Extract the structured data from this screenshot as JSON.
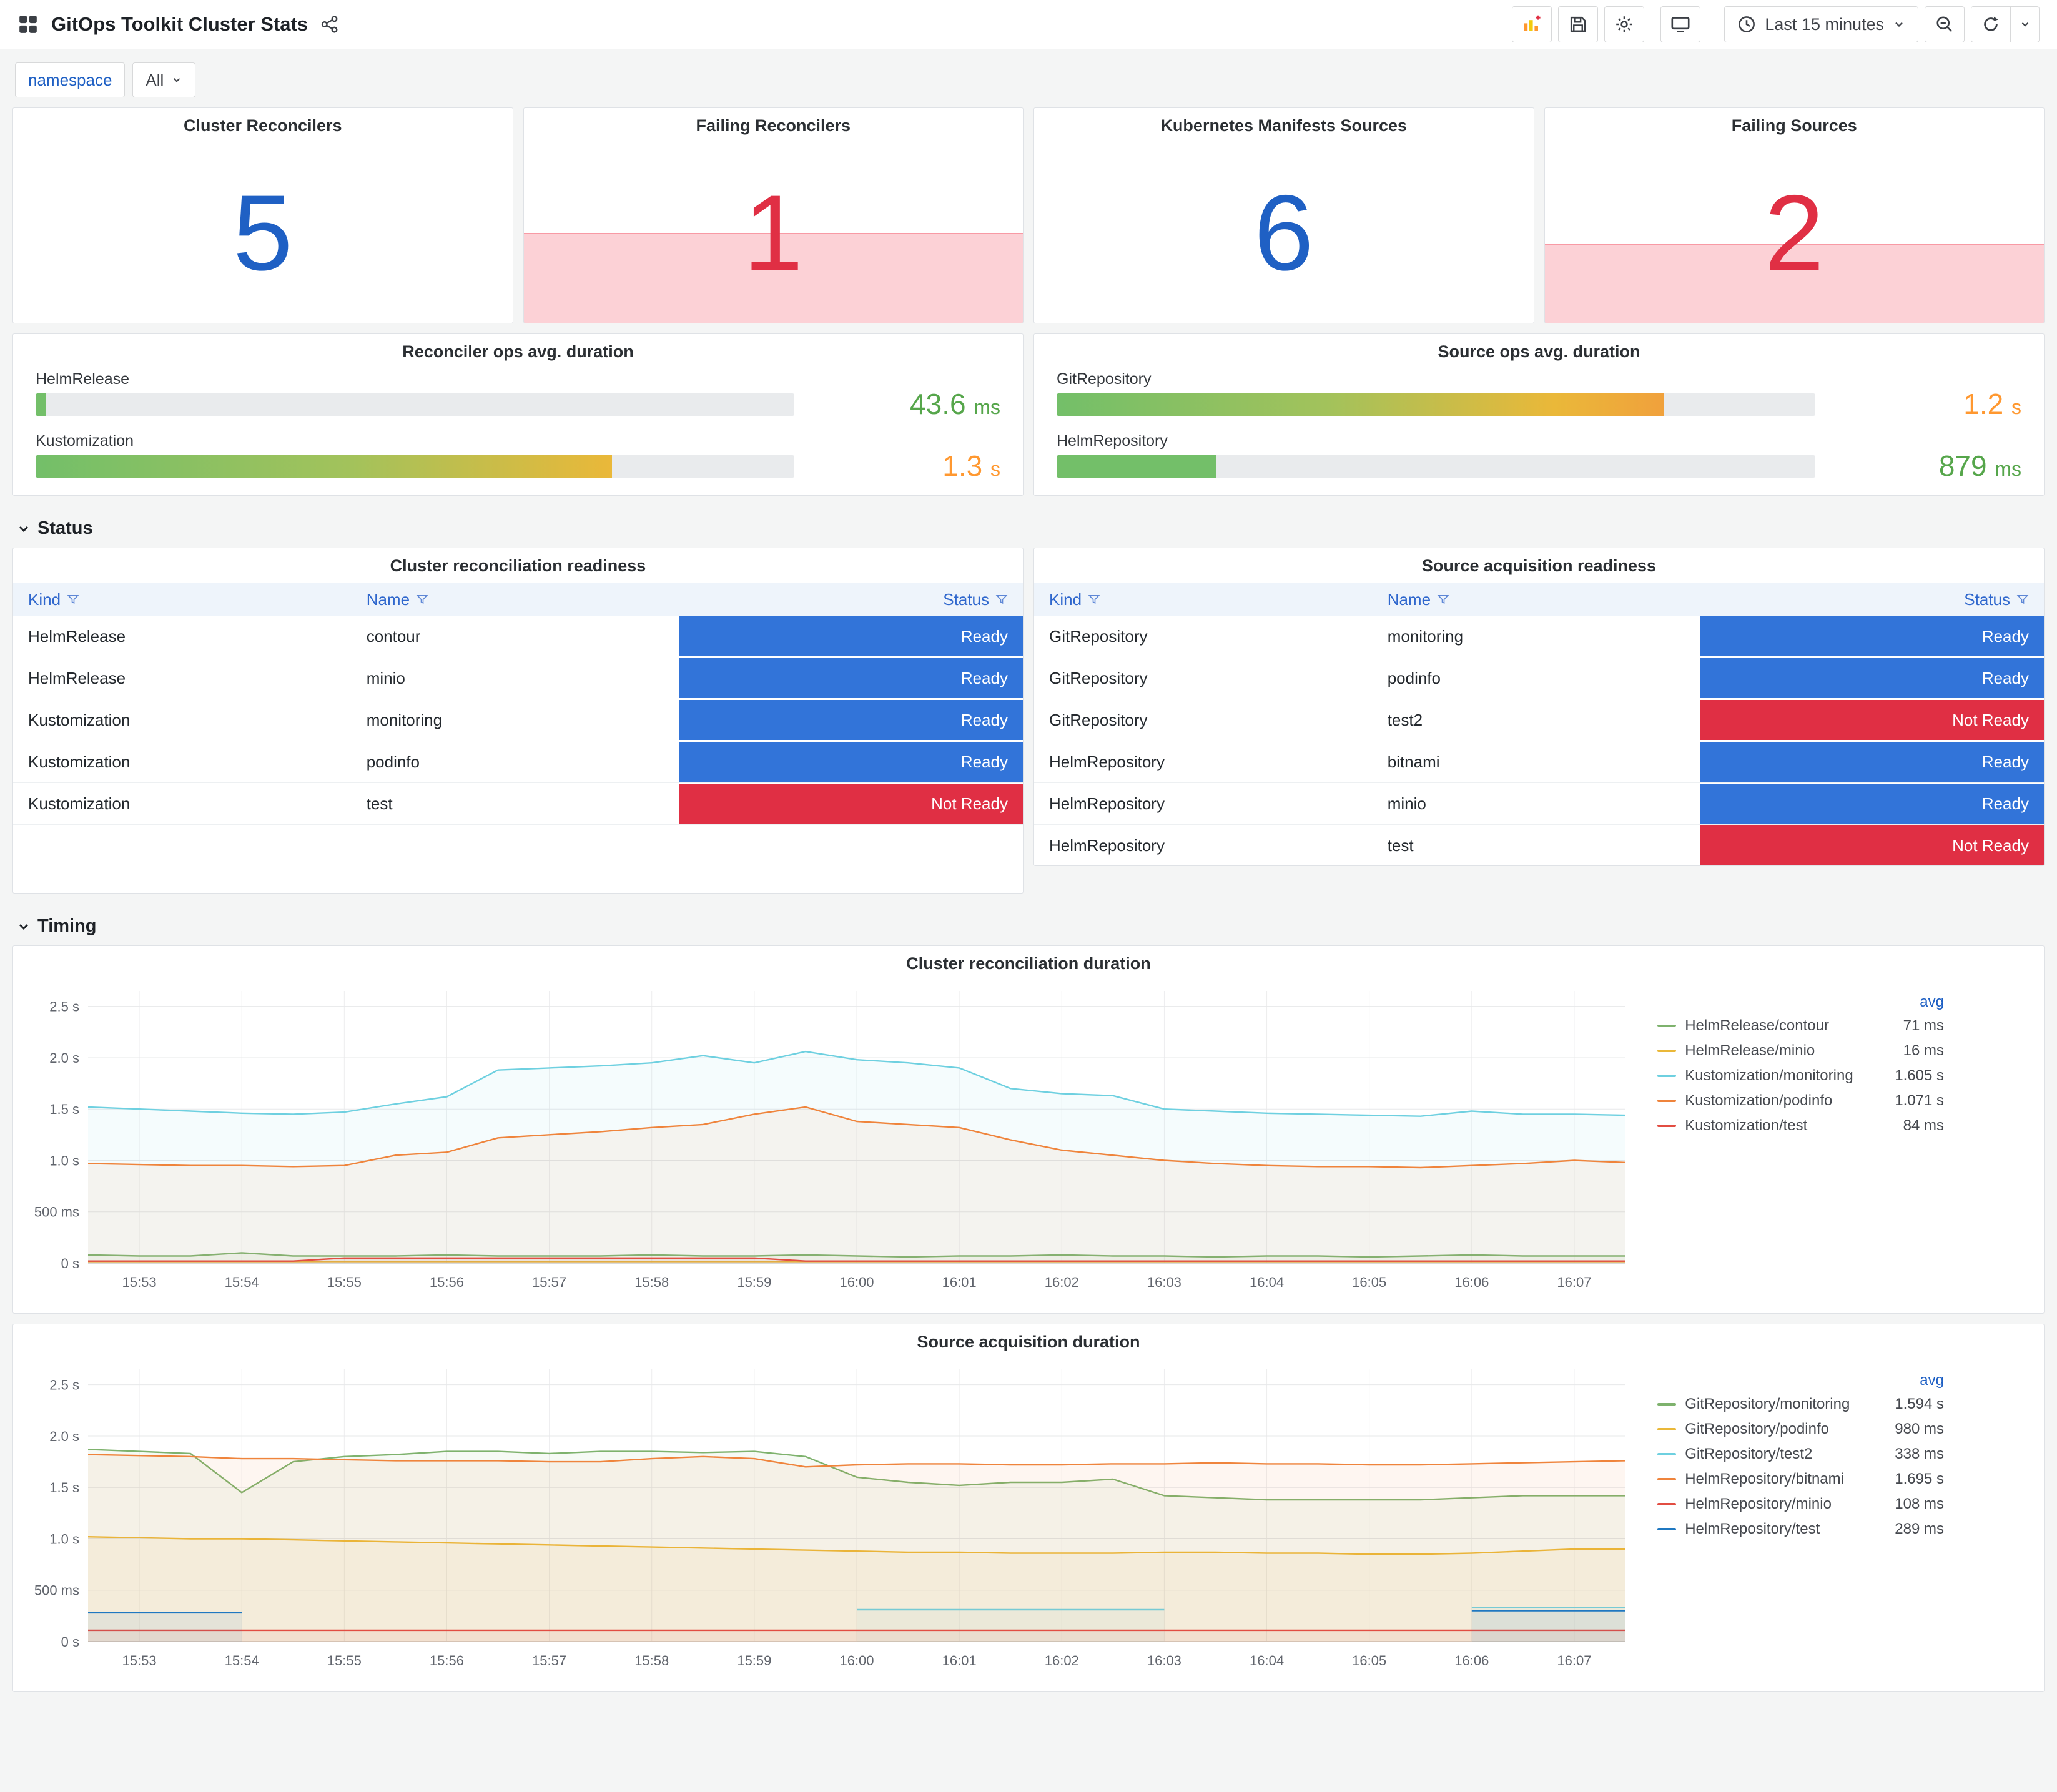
{
  "header": {
    "title": "GitOps Toolkit Cluster Stats",
    "time_picker": "Last 15 minutes"
  },
  "icons": {
    "dashboards-icon": "four-square grid",
    "share-icon": "share-alt nodes",
    "add-panel-icon": "bar chart with plus",
    "save-icon": "floppy disk",
    "settings-icon": "gear",
    "tv-icon": "monitor",
    "clock-icon": "clock",
    "caret-down-icon": "chevron down",
    "zoom-out-icon": "magnifier with minus",
    "refresh-icon": "circular arrow",
    "filter-icon": "funnel",
    "section-chevron-icon": "chevron down"
  },
  "variables": {
    "namespace_label": "namespace",
    "namespace_value": "All"
  },
  "sections": {
    "status": "Status",
    "timing": "Timing"
  },
  "stats": [
    {
      "title": "Cluster Reconcilers",
      "value": "5",
      "color": "#1F60C4",
      "band": false,
      "band_height_pct": 0
    },
    {
      "title": "Failing Reconcilers",
      "value": "1",
      "color": "#E02F44",
      "band": true,
      "band_height_pct": 42
    },
    {
      "title": "Kubernetes Manifests Sources",
      "value": "6",
      "color": "#1F60C4",
      "band": false,
      "band_height_pct": 0
    },
    {
      "title": "Failing Sources",
      "value": "2",
      "color": "#E02F44",
      "band": true,
      "band_height_pct": 37
    }
  ],
  "gauges": [
    {
      "title": "Reconciler ops avg. duration",
      "rows": [
        {
          "label": "HelmRelease",
          "value": "43.6",
          "unit": "ms",
          "percent": 1.3,
          "bar_colors": [
            "#73BF69",
            "#73BF69"
          ],
          "value_color": "#56A64B"
        },
        {
          "label": "Kustomization",
          "value": "1.3",
          "unit": "s",
          "percent": 76,
          "bar_colors": [
            "#73BF69",
            "#A3C25B 55%",
            "#EAB839"
          ],
          "value_color": "#FF9830"
        }
      ]
    },
    {
      "title": "Source ops avg. duration",
      "rows": [
        {
          "label": "GitRepository",
          "value": "1.2",
          "unit": "s",
          "percent": 80,
          "bar_colors": [
            "#73BF69",
            "#A3C25B 45%",
            "#EAB839 82%",
            "#F0A13C"
          ],
          "value_color": "#FF9830"
        },
        {
          "label": "HelmRepository",
          "value": "879",
          "unit": "ms",
          "percent": 21,
          "bar_colors": [
            "#73BF69",
            "#73BF69"
          ],
          "value_color": "#56A64B"
        }
      ]
    }
  ],
  "status_colors": {
    "Ready": "#3274D9",
    "Not Ready": "#E02F44"
  },
  "tables": [
    {
      "title": "Cluster reconciliation readiness",
      "columns": [
        "Kind",
        "Name",
        "Status"
      ],
      "rows": [
        {
          "kind": "HelmRelease",
          "name": "contour",
          "status": "Ready"
        },
        {
          "kind": "HelmRelease",
          "name": "minio",
          "status": "Ready"
        },
        {
          "kind": "Kustomization",
          "name": "monitoring",
          "status": "Ready"
        },
        {
          "kind": "Kustomization",
          "name": "podinfo",
          "status": "Ready"
        },
        {
          "kind": "Kustomization",
          "name": "test",
          "status": "Not Ready"
        }
      ]
    },
    {
      "title": "Source acquisition readiness",
      "columns": [
        "Kind",
        "Name",
        "Status"
      ],
      "rows": [
        {
          "kind": "GitRepository",
          "name": "monitoring",
          "status": "Ready"
        },
        {
          "kind": "GitRepository",
          "name": "podinfo",
          "status": "Ready"
        },
        {
          "kind": "GitRepository",
          "name": "test2",
          "status": "Not Ready"
        },
        {
          "kind": "HelmRepository",
          "name": "bitnami",
          "status": "Ready"
        },
        {
          "kind": "HelmRepository",
          "name": "minio",
          "status": "Ready"
        },
        {
          "kind": "HelmRepository",
          "name": "test",
          "status": "Not Ready"
        }
      ]
    }
  ],
  "chart_data": [
    {
      "type": "line",
      "title": "Cluster reconciliation duration",
      "x_start": "15:52:30",
      "x_step_seconds": 30,
      "x_ticks": [
        "15:53",
        "15:54",
        "15:55",
        "15:56",
        "15:57",
        "15:58",
        "15:59",
        "16:00",
        "16:01",
        "16:02",
        "16:03",
        "16:04",
        "16:05",
        "16:06",
        "16:07"
      ],
      "y_ticks": [
        "0 s",
        "500 ms",
        "1.0 s",
        "1.5 s",
        "2.0 s",
        "2.5 s"
      ],
      "y_tick_values": [
        0,
        0.5,
        1,
        1.5,
        2,
        2.5
      ],
      "ylim": [
        0,
        2.65
      ],
      "unit": "seconds",
      "grid": true,
      "legend_position": "right",
      "legend_value_label": "avg",
      "series": [
        {
          "name": "HelmRelease/contour",
          "color": "#7EB26D",
          "avg": "71 ms",
          "values": [
            0.08,
            0.07,
            0.07,
            0.1,
            0.07,
            0.07,
            0.07,
            0.08,
            0.07,
            0.07,
            0.07,
            0.08,
            0.07,
            0.07,
            0.08,
            0.07,
            0.06,
            0.07,
            0.07,
            0.08,
            0.07,
            0.07,
            0.06,
            0.07,
            0.07,
            0.06,
            0.07,
            0.08,
            0.07,
            0.07,
            0.07
          ]
        },
        {
          "name": "HelmRelease/minio",
          "color": "#EAB839",
          "avg": "16 ms",
          "values": [
            0.016,
            0.016,
            0.016,
            0.016,
            0.016,
            0.016,
            0.016,
            0.016,
            0.016,
            0.016,
            0.016,
            0.016,
            0.016,
            0.016,
            0.016,
            0.016,
            0.016,
            0.016,
            0.016,
            0.016,
            0.016,
            0.016,
            0.016,
            0.016,
            0.016,
            0.016,
            0.016,
            0.016,
            0.016,
            0.016,
            0.016
          ]
        },
        {
          "name": "Kustomization/monitoring",
          "color": "#6ED0E0",
          "avg": "1.605 s",
          "values": [
            1.52,
            1.5,
            1.48,
            1.46,
            1.45,
            1.47,
            1.55,
            1.62,
            1.88,
            1.9,
            1.92,
            1.95,
            2.02,
            1.95,
            2.06,
            1.98,
            1.95,
            1.9,
            1.7,
            1.65,
            1.63,
            1.5,
            1.48,
            1.46,
            1.45,
            1.44,
            1.43,
            1.48,
            1.45,
            1.45,
            1.44
          ]
        },
        {
          "name": "Kustomization/podinfo",
          "color": "#EF843C",
          "avg": "1.071 s",
          "values": [
            0.97,
            0.96,
            0.95,
            0.95,
            0.94,
            0.95,
            1.05,
            1.08,
            1.22,
            1.25,
            1.28,
            1.32,
            1.35,
            1.45,
            1.52,
            1.38,
            1.35,
            1.32,
            1.2,
            1.1,
            1.05,
            1.0,
            0.97,
            0.95,
            0.94,
            0.94,
            0.93,
            0.95,
            0.97,
            1.0,
            0.98
          ]
        },
        {
          "name": "Kustomization/test",
          "color": "#E24D42",
          "avg": "84 ms",
          "values": [
            0.02,
            0.02,
            0.02,
            0.02,
            0.02,
            0.05,
            0.05,
            0.05,
            0.05,
            0.05,
            0.05,
            0.05,
            0.05,
            0.05,
            0.02,
            0.02,
            0.02,
            0.02,
            0.02,
            0.02,
            0.02,
            0.02,
            0.02,
            0.02,
            0.02,
            0.02,
            0.02,
            0.02,
            0.02,
            0.02,
            0.02
          ]
        }
      ]
    },
    {
      "type": "line",
      "title": "Source acquisition duration",
      "x_start": "15:52:30",
      "x_step_seconds": 30,
      "x_ticks": [
        "15:53",
        "15:54",
        "15:55",
        "15:56",
        "15:57",
        "15:58",
        "15:59",
        "16:00",
        "16:01",
        "16:02",
        "16:03",
        "16:04",
        "16:05",
        "16:06",
        "16:07"
      ],
      "y_ticks": [
        "0 s",
        "500 ms",
        "1.0 s",
        "1.5 s",
        "2.0 s",
        "2.5 s"
      ],
      "y_tick_values": [
        0,
        0.5,
        1,
        1.5,
        2,
        2.5
      ],
      "ylim": [
        0,
        2.65
      ],
      "unit": "seconds",
      "grid": true,
      "legend_position": "right",
      "legend_value_label": "avg",
      "series": [
        {
          "name": "GitRepository/monitoring",
          "color": "#7EB26D",
          "avg": "1.594 s",
          "values": [
            1.87,
            1.85,
            1.83,
            1.45,
            1.75,
            1.8,
            1.82,
            1.85,
            1.85,
            1.83,
            1.85,
            1.85,
            1.84,
            1.85,
            1.8,
            1.6,
            1.55,
            1.52,
            1.55,
            1.55,
            1.58,
            1.42,
            1.4,
            1.38,
            1.38,
            1.38,
            1.38,
            1.4,
            1.42,
            1.42,
            1.42
          ]
        },
        {
          "name": "GitRepository/podinfo",
          "color": "#EAB839",
          "avg": "980 ms",
          "values": [
            1.02,
            1.01,
            1.0,
            1.0,
            0.99,
            0.98,
            0.97,
            0.96,
            0.95,
            0.94,
            0.93,
            0.92,
            0.91,
            0.9,
            0.89,
            0.88,
            0.87,
            0.87,
            0.86,
            0.86,
            0.86,
            0.87,
            0.87,
            0.86,
            0.86,
            0.85,
            0.85,
            0.86,
            0.88,
            0.9,
            0.9
          ]
        },
        {
          "name": "GitRepository/test2",
          "color": "#6ED0E0",
          "avg": "338 ms",
          "values": [
            null,
            null,
            null,
            null,
            null,
            null,
            null,
            null,
            null,
            null,
            null,
            null,
            null,
            null,
            null,
            0.31,
            0.31,
            0.31,
            0.31,
            0.31,
            0.31,
            0.31,
            null,
            null,
            null,
            null,
            null,
            0.33,
            0.33,
            0.33,
            0.33
          ]
        },
        {
          "name": "HelmRepository/bitnami",
          "color": "#EF843C",
          "avg": "1.695 s",
          "values": [
            1.82,
            1.81,
            1.8,
            1.78,
            1.78,
            1.77,
            1.76,
            1.76,
            1.76,
            1.75,
            1.75,
            1.78,
            1.8,
            1.78,
            1.7,
            1.72,
            1.73,
            1.73,
            1.72,
            1.72,
            1.73,
            1.73,
            1.74,
            1.73,
            1.73,
            1.72,
            1.72,
            1.73,
            1.74,
            1.75,
            1.76
          ]
        },
        {
          "name": "HelmRepository/minio",
          "color": "#E24D42",
          "avg": "108 ms",
          "values": [
            0.11,
            0.11,
            0.11,
            0.11,
            0.11,
            0.11,
            0.11,
            0.11,
            0.11,
            0.11,
            0.11,
            0.11,
            0.11,
            0.11,
            0.11,
            0.11,
            0.11,
            0.11,
            0.11,
            0.11,
            0.11,
            0.11,
            0.11,
            0.11,
            0.11,
            0.11,
            0.11,
            0.11,
            0.11,
            0.11,
            0.11
          ]
        },
        {
          "name": "HelmRepository/test",
          "color": "#1F78C1",
          "avg": "289 ms",
          "values": [
            0.28,
            0.28,
            0.28,
            0.28,
            null,
            null,
            null,
            null,
            null,
            null,
            null,
            null,
            null,
            null,
            null,
            null,
            null,
            null,
            null,
            null,
            null,
            null,
            null,
            null,
            null,
            null,
            null,
            0.3,
            0.3,
            0.3,
            0.3
          ]
        }
      ]
    }
  ]
}
